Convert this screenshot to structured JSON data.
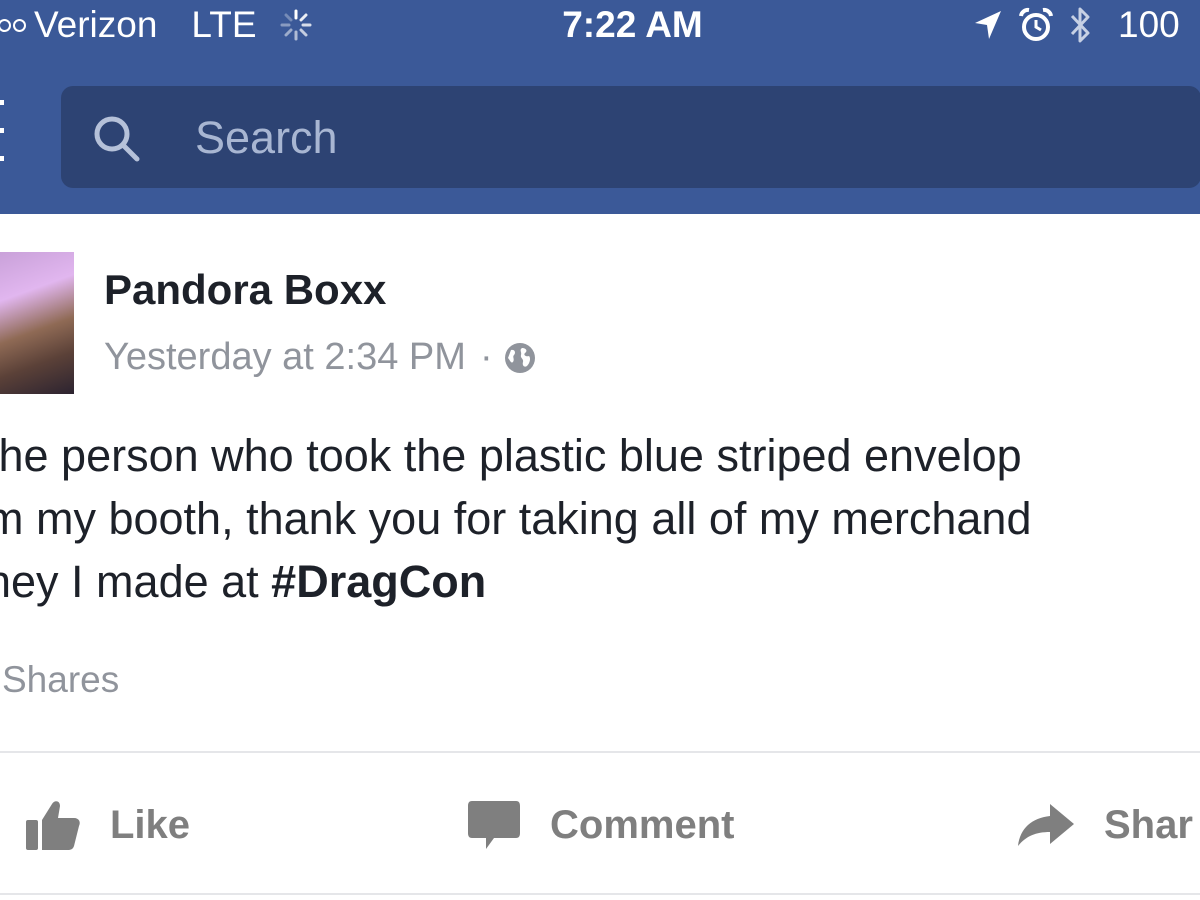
{
  "status_bar": {
    "carrier": "Verizon",
    "network": "LTE",
    "time": "7:22 AM",
    "battery": "100"
  },
  "search": {
    "placeholder": "Search"
  },
  "post": {
    "author": "Pandora Boxx",
    "timestamp": "Yesterday at 2:34 PM",
    "separator": "·",
    "privacy_icon": "globe-icon",
    "text_lines": [
      "the person who took the plastic blue striped envelop",
      "m my booth, thank you for taking all of my merchand",
      "ney I made at "
    ],
    "hashtag": "#DragCon",
    "shares": "Shares"
  },
  "actions": {
    "like": "Like",
    "comment": "Comment",
    "share": "Shar"
  },
  "colors": {
    "header": "#3b5998",
    "search_bg": "#2d4373",
    "muted_text": "#90949c",
    "action_text": "#7f7f7f"
  }
}
